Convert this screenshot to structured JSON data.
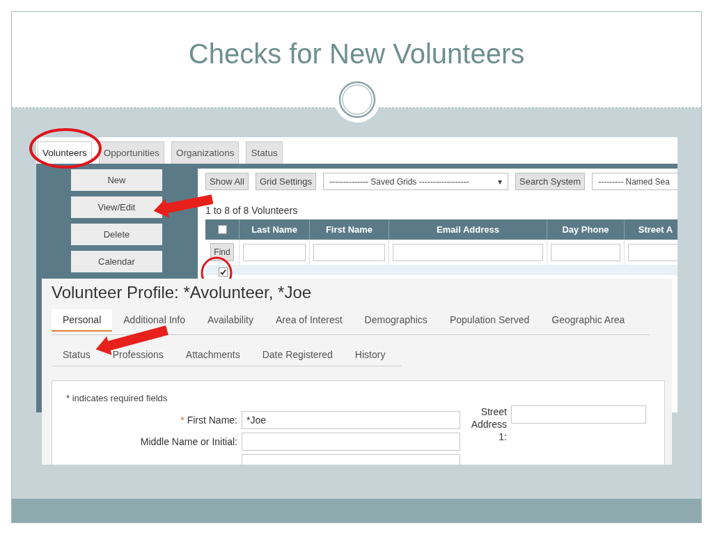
{
  "slide": {
    "title": "Checks for New Volunteers"
  },
  "volunteers_screen": {
    "tabs": [
      {
        "label": "Volunteers",
        "selected": true
      },
      {
        "label": "Opportunities",
        "selected": false
      },
      {
        "label": "Organizations",
        "selected": false
      },
      {
        "label": "Status",
        "selected": false
      }
    ],
    "actions": [
      "New",
      "View/Edit",
      "Delete",
      "Calendar"
    ],
    "toolbar": [
      {
        "kind": "button",
        "label": "Show All"
      },
      {
        "kind": "button",
        "label": "Grid Settings"
      },
      {
        "kind": "select",
        "label": "-------------- Saved Grids ------------------",
        "caret": "▾"
      },
      {
        "kind": "button",
        "label": "Search System"
      },
      {
        "kind": "select",
        "label": "--------- Named Sea"
      }
    ],
    "count": "1 to 8 of 8 Volunteers",
    "table": {
      "select_all": false,
      "columns": [
        "Last Name",
        "First Name",
        "Email Address",
        "Day Phone",
        "Street A"
      ],
      "filter_button": "Find",
      "rows": [
        {
          "checked": true
        }
      ]
    }
  },
  "profile_screen": {
    "title": "Volunteer Profile: *Avolunteer, *Joe",
    "tab_rows": [
      [
        {
          "label": "Personal",
          "selected": true
        },
        {
          "label": "Additional Info",
          "selected": false
        },
        {
          "label": "Availability",
          "selected": false
        },
        {
          "label": "Area of Interest",
          "selected": false
        },
        {
          "label": "Demographics",
          "selected": false
        },
        {
          "label": "Population Served",
          "selected": false
        },
        {
          "label": "Geographic Area",
          "selected": false
        }
      ],
      [
        {
          "label": "Status",
          "selected": false
        },
        {
          "label": "Professions",
          "selected": false
        },
        {
          "label": "Attachments",
          "selected": false
        },
        {
          "label": "Date Registered",
          "selected": false
        },
        {
          "label": "History",
          "selected": false
        }
      ]
    ],
    "note": "* indicates required fields",
    "required_mark": "*",
    "fields": [
      {
        "label": "First Name:",
        "required": true,
        "value": "*Joe"
      },
      {
        "label": "Middle Name or Initial:",
        "required": false
      }
    ],
    "address_fields": [
      {
        "label": "Street Address 1:"
      }
    ]
  }
}
